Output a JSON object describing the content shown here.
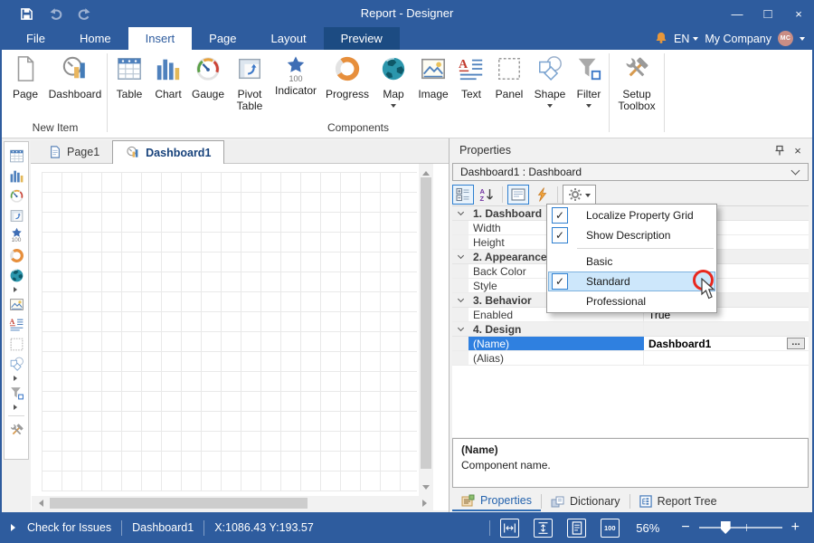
{
  "titlebar": {
    "title": "Report - Designer",
    "minimize": "—",
    "maximize": "□",
    "close": "×"
  },
  "nav": {
    "tabs": [
      "File",
      "Home",
      "Insert",
      "Page",
      "Layout",
      "Preview"
    ],
    "language": "EN",
    "company": "My Company",
    "avatar": "MC"
  },
  "ribbon": {
    "new_item": {
      "label": "New Item",
      "items": [
        "Page",
        "Dashboard"
      ]
    },
    "components": {
      "label": "Components",
      "items": [
        "Table",
        "Chart",
        "Gauge",
        "Pivot Table",
        "Indicator",
        "Progress",
        "Map",
        "Image",
        "Text",
        "Panel",
        "Shape",
        "Filter"
      ]
    },
    "setup": {
      "label": "Setup Toolbox"
    },
    "indicator_badge": "100"
  },
  "doc_tabs": {
    "page": "Page1",
    "dashboard": "Dashboard1"
  },
  "props": {
    "title": "Properties",
    "selector": "Dashboard1 : Dashboard",
    "rows": [
      {
        "label": "1. Dashboard",
        "value": "",
        "kind": "category"
      },
      {
        "label": "Width",
        "value": "",
        "kind": "prop"
      },
      {
        "label": "Height",
        "value": "",
        "kind": "prop"
      },
      {
        "label": "2. Appearance",
        "value": "",
        "kind": "category"
      },
      {
        "label": "Back Color",
        "value": "",
        "kind": "prop"
      },
      {
        "label": "Style",
        "value": "",
        "kind": "prop"
      },
      {
        "label": "3. Behavior",
        "value": "",
        "kind": "category"
      },
      {
        "label": "Enabled",
        "value": "True",
        "kind": "prop"
      },
      {
        "label": "4. Design",
        "value": "",
        "kind": "category"
      },
      {
        "label": "(Name)",
        "value": "Dashboard1",
        "kind": "prop-selected"
      },
      {
        "label": "(Alias)",
        "value": "",
        "kind": "prop"
      }
    ],
    "ellipsis": "…",
    "menu": {
      "items": [
        {
          "label": "Localize Property Grid",
          "check": "✓"
        },
        {
          "label": "Show Description",
          "check": "✓"
        },
        {
          "label": "Basic",
          "check": ""
        },
        {
          "label": "Standard",
          "check": "✓"
        },
        {
          "label": "Professional",
          "check": ""
        }
      ]
    },
    "desc": {
      "title": "(Name)",
      "body": "Component name."
    },
    "tabs": [
      "Properties",
      "Dictionary",
      "Report Tree"
    ]
  },
  "status": {
    "issues": "Check for Issues",
    "page": "Dashboard1",
    "coords": "X:1086.43 Y:193.57",
    "zoom": "56%",
    "zoom100": "100",
    "minus": "−",
    "plus": "+"
  },
  "icons": {
    "quick_access": [
      "save-icon",
      "undo-icon",
      "redo-icon"
    ],
    "notification": "bell-icon",
    "props_toolbar": [
      "categorized-icon",
      "sort-az-icon",
      "description-icon",
      "events-icon",
      "settings-gear-icon"
    ],
    "status_zoom": [
      "fit-page-width-icon",
      "fit-page-height-icon",
      "whole-page-icon",
      "zoom-100-icon"
    ]
  },
  "colors": {
    "titlebar": "#2e5c9e",
    "preview_tab": "#1c4b82",
    "selection": "#2f80e0",
    "menu_highlight": "#cde7fb",
    "bell": "#e8973a",
    "avatar": "#c98d85",
    "annotation": "#e8281e"
  }
}
